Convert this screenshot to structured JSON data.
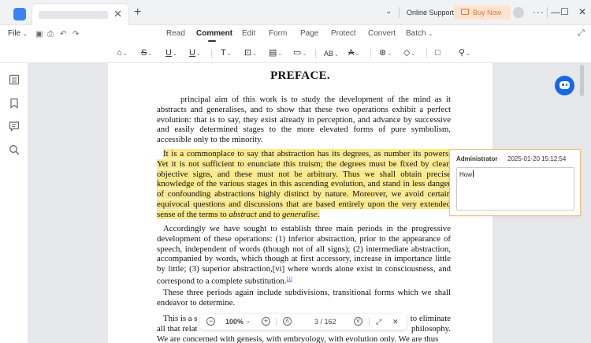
{
  "titlebar": {
    "new_tab": "+",
    "tab_close": "✕",
    "online_support": "Online Support",
    "buy_now": "Buy Now",
    "more": "···",
    "minimize": "—",
    "maximize": "☐",
    "close": "✕"
  },
  "menu": {
    "file": "File",
    "tabs": [
      "Read",
      "Comment",
      "Edit",
      "Form",
      "Page",
      "Protect",
      "Convert",
      "Batch"
    ],
    "active_tab": "Comment"
  },
  "document": {
    "title": "PREFACE.",
    "p1": "principal aim of this work is to study the development of the mind as it abstracts and generalises, and to show that these two operations exhibit a perfect evolution: that is to say, they exist already in perception, and advance by successive and easily determined stages to the more elevated forms of pure symbolism, accessible only to the minority.",
    "p2_a": "It is a commonplace to say that abstraction has its degrees, as number its powers. Yet it is not sufficient to enunciate this truism; the degrees must be fixed by clear, objective signs, and these must not be arbitrary. Thus we shall obtain precise knowledge of the various stages in this ascending evolution, and stand in less danger of confounding abstractions highly distinct by nature. Moreover, we avoid certain equivocal questions and discussions that are based entirely upon the very extended sense of the terms to ",
    "p2_em1": "abstract",
    "p2_and": " and to ",
    "p2_em2": "generalise",
    "p2_end": ".",
    "p3": "Accordingly we have sought to establish three main periods in the progressive development of these operations: (1) inferior abstraction, prior to the appearance of speech, independent of words (though not of all signs); (2) intermediate abstraction, accompanied by words, which though at first accessory, increase in importance little by little; (3) superior abstraction,[vi] where words alone exist in consciousness, and correspond to a complete substitution.",
    "p3_fn": "[1]",
    "p4": "These three periods again include subdivisions, transitional forms which we shall endeavor to determine.",
    "p5_l1a": "This is a s",
    "p5_l1b": "to eliminate",
    "p5_l2a": "all that relat",
    "p5_l2b": "philosophy.",
    "p5_l3": "We are concerned with genesis, with embryology, with evolution only. We are thus"
  },
  "comment": {
    "author": "Administrator",
    "time": "2025-01-20 15:12:54",
    "text": "How"
  },
  "zoombar": {
    "zoom": "100%",
    "page_current": "3",
    "page_total": "162",
    "page_display": "3 / 162"
  },
  "colors": {
    "highlight": "#fbe98d",
    "accent": "#1767e6",
    "buy_now_bg": "#fde3d0",
    "buy_now_text": "#e8772e"
  }
}
